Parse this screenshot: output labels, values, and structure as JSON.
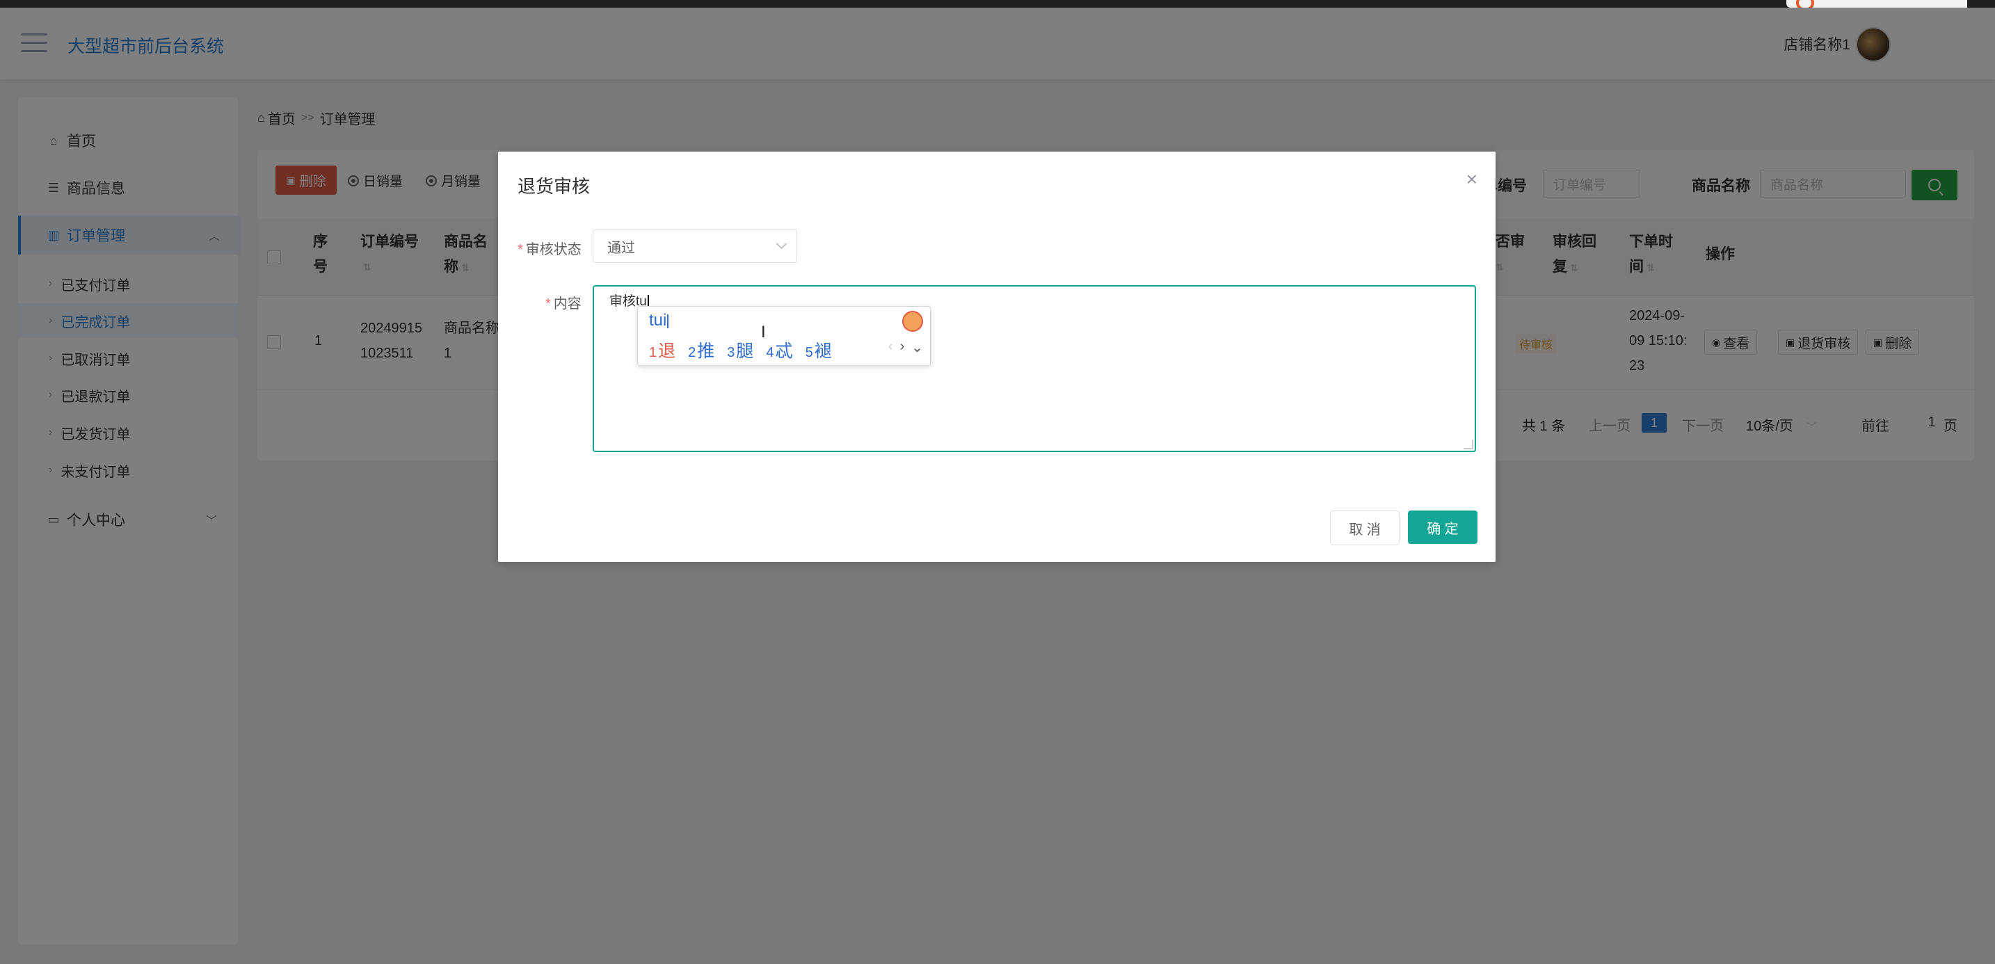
{
  "header": {
    "system_title": "大型超市前后台系统",
    "shop_name": "店铺名称1"
  },
  "sidebar": {
    "items": [
      {
        "label": "首页"
      },
      {
        "label": "商品信息"
      },
      {
        "label": "订单管理"
      },
      {
        "label": "个人中心"
      }
    ],
    "order_sub_items": [
      {
        "label": "已支付订单"
      },
      {
        "label": "已完成订单"
      },
      {
        "label": "已取消订单"
      },
      {
        "label": "已退款订单"
      },
      {
        "label": "已发货订单"
      },
      {
        "label": "未支付订单"
      }
    ]
  },
  "breadcrumb": {
    "home": "首页",
    "separator": ">>",
    "current": "订单管理"
  },
  "toolbar": {
    "delete_label": "删除",
    "daily_sales_label": "日销量",
    "monthly_sales_label": "月销量",
    "order_no_label": "单编号",
    "order_no_placeholder": "订单编号",
    "product_name_label": "商品名称",
    "product_name_placeholder": "商品名称"
  },
  "table": {
    "headers": {
      "index": [
        "序",
        "号"
      ],
      "order_no": "订单编号",
      "product_name": [
        "商品名",
        "称"
      ],
      "review": [
        "否审",
        ""
      ],
      "review_reply": [
        "审核回",
        "复"
      ],
      "order_time": [
        "下单时",
        "间"
      ],
      "actions": "操作"
    },
    "rows": [
      {
        "index": "1",
        "order_no": [
          "20249915",
          "1023511"
        ],
        "product_name": [
          "商品名称",
          "1"
        ],
        "status": "待审核",
        "order_time": [
          "2024-09-",
          "09 15:10:",
          "23"
        ],
        "view_label": "查看",
        "return_review_label": "退货审核",
        "delete_label": "删除"
      }
    ]
  },
  "pagination": {
    "total": "共 1 条",
    "prev": "上一页",
    "current_page": "1",
    "next": "下一页",
    "page_size": "10条/页",
    "goto_label": "前往",
    "goto_value": "1",
    "page_suffix": "页"
  },
  "modal": {
    "title": "退货审核",
    "status_label": "审核状态",
    "status_value": "通过",
    "content_label": "内容",
    "content_value": "审核tu",
    "cancel_label": "取 消",
    "confirm_label": "确 定"
  },
  "ime": {
    "pinyin": "tui",
    "candidates": [
      {
        "n": "1",
        "ch": "退"
      },
      {
        "n": "2",
        "ch": "推"
      },
      {
        "n": "3",
        "ch": "腿"
      },
      {
        "n": "4",
        "ch": "忒"
      },
      {
        "n": "5",
        "ch": "褪"
      }
    ]
  },
  "colors": {
    "primary": "#2d7fd2",
    "teal": "#13a596",
    "danger": "#e15a45",
    "success": "#25a244"
  }
}
